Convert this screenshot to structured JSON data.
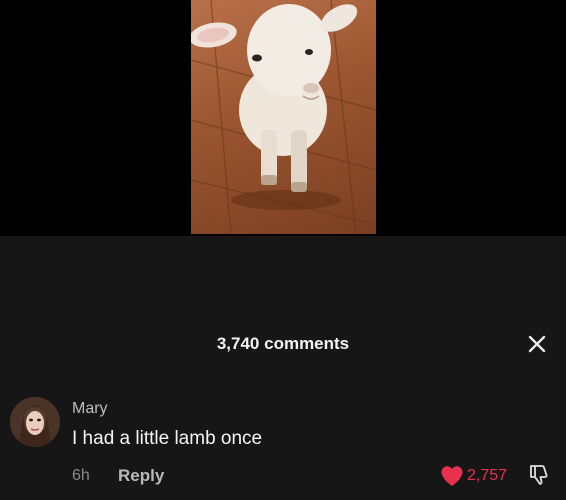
{
  "video": {
    "media": "lamb-video-thumbnail"
  },
  "comments_sheet": {
    "count_label": "3,740 comments",
    "close_icon": "close-icon"
  },
  "comment": {
    "username": "Mary",
    "text": "I had a little lamb once",
    "time": "6h",
    "reply_label": "Reply",
    "like_count": "2,757",
    "liked": true,
    "like_icon": "heart-icon",
    "dislike_icon": "thumbs-down-icon",
    "avatar": "user-avatar"
  },
  "colors": {
    "sheet_bg": "#161616",
    "like_red": "#e8304f",
    "background": "#000000"
  }
}
